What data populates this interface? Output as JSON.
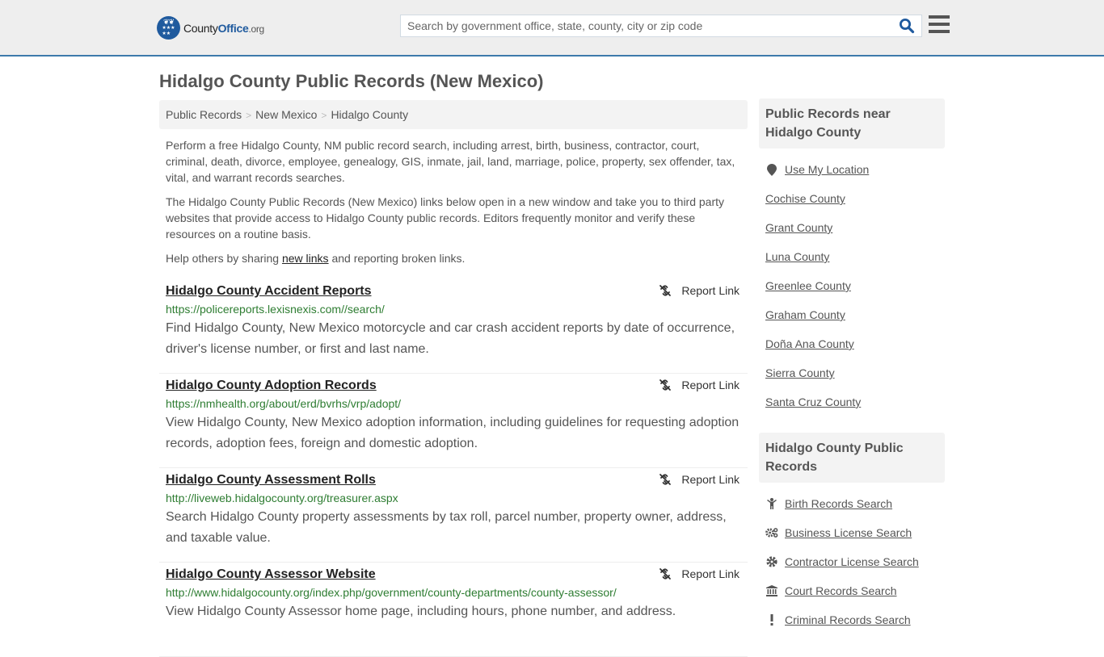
{
  "header": {
    "logo": {
      "county": "County",
      "office": "Office",
      "org": ".org",
      "icon": "eagle-stars-badge"
    },
    "search": {
      "placeholder": "Search by government office, state, county, city or zip code",
      "value": "",
      "icon": "search-icon"
    },
    "menu_icon": "hamburger-icon",
    "accent_color": "#3d7aab"
  },
  "page": {
    "title": "Hidalgo County Public Records (New Mexico)"
  },
  "breadcrumb": [
    {
      "label": "Public Records"
    },
    {
      "label": "New Mexico"
    },
    {
      "label": "Hidalgo County"
    }
  ],
  "breadcrumb_separator": ">",
  "intro": {
    "p1": "Perform a free Hidalgo County, NM public record search, including arrest, birth, business, contractor, court, criminal, death, divorce, employee, genealogy, GIS, inmate, jail, land, marriage, police, property, sex offender, tax, vital, and warrant records searches.",
    "p2": "The Hidalgo County Public Records (New Mexico) links below open in a new window and take you to third party websites that provide access to Hidalgo County public records. Editors frequently monitor and verify these resources on a routine basis.",
    "p3_before": "Help others by sharing ",
    "p3_link": "new links",
    "p3_after": " and reporting broken links."
  },
  "records": [
    {
      "title": "Hidalgo County Accident Reports",
      "url": "https://policereports.lexisnexis.com//search/",
      "description": "Find Hidalgo County, New Mexico motorcycle and car crash accident reports by date of occurrence, driver's license number, or first and last name.",
      "report_label": "Report Link"
    },
    {
      "title": "Hidalgo County Adoption Records",
      "url": "https://nmhealth.org/about/erd/bvrhs/vrp/adopt/",
      "description": "View Hidalgo County, New Mexico adoption information, including guidelines for requesting adoption records, adoption fees, foreign and domestic adoption.",
      "report_label": "Report Link"
    },
    {
      "title": "Hidalgo County Assessment Rolls",
      "url": "http://liveweb.hidalgocounty.org/treasurer.aspx",
      "description": "Search Hidalgo County property assessments by tax roll, parcel number, property owner, address, and taxable value.",
      "report_label": "Report Link"
    },
    {
      "title": "Hidalgo County Assessor Website",
      "url": "http://www.hidalgocounty.org/index.php/government/county-departments/county-assessor/",
      "description": "View Hidalgo County Assessor home page, including hours, phone number, and address.",
      "report_label": "Report Link"
    }
  ],
  "sidebar": {
    "nearby": {
      "heading": "Public Records near Hidalgo County",
      "use_location": {
        "label": "Use My Location",
        "icon": "map-pin-icon"
      },
      "items": [
        {
          "label": "Cochise County"
        },
        {
          "label": "Grant County"
        },
        {
          "label": "Luna County"
        },
        {
          "label": "Greenlee County"
        },
        {
          "label": "Graham County"
        },
        {
          "label": "Doña Ana County"
        },
        {
          "label": "Sierra County"
        },
        {
          "label": "Santa Cruz County"
        }
      ]
    },
    "county_records": {
      "heading": "Hidalgo County Public Records",
      "items": [
        {
          "label": "Birth Records Search",
          "icon": "child-icon"
        },
        {
          "label": "Business License Search",
          "icon": "gears-icon"
        },
        {
          "label": "Contractor License Search",
          "icon": "gear-icon"
        },
        {
          "label": "Court Records Search",
          "icon": "courthouse-icon"
        },
        {
          "label": "Criminal Records Search",
          "icon": "exclamation-icon"
        }
      ]
    }
  }
}
